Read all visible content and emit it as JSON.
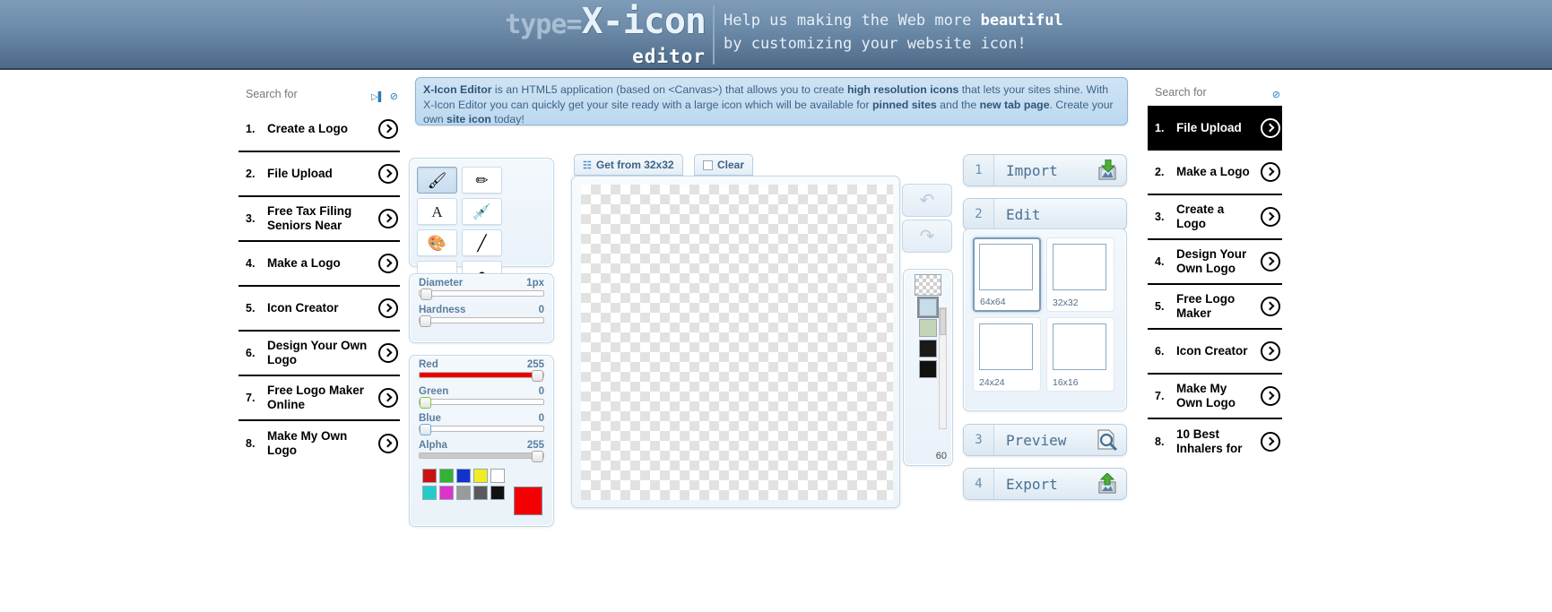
{
  "header": {
    "logo_type": "type=",
    "logo_name": "X-icon",
    "logo_sub": "editor",
    "tagline_line1_pre": "Help us making the Web more ",
    "tagline_line1_bold": "beautiful",
    "tagline_line2": "by customizing your website icon!"
  },
  "info_banner": {
    "b1": "X-Icon Editor",
    "t1": " is an HTML5 application (based on <Canvas>) that allows you to create ",
    "b2": "high resolution icons",
    "t2": " that lets your sites shine. With X-Icon Editor you can quickly get your site ready with a large icon which will be available for ",
    "b3": "pinned sites",
    "t3": " and the ",
    "b4": "new tab page",
    "t4": ". Create your own ",
    "b5": "site icon",
    "t5": " today!"
  },
  "ads_left": {
    "heading": "Search for",
    "adchoices_label": "▷▐",
    "hide_icon": "eye-slash-icon",
    "items": [
      {
        "num": "1.",
        "label": "Create a Logo"
      },
      {
        "num": "2.",
        "label": "File Upload"
      },
      {
        "num": "3.",
        "label": "Free Tax Filing Seniors Near"
      },
      {
        "num": "4.",
        "label": "Make a Logo"
      },
      {
        "num": "5.",
        "label": "Icon Creator"
      },
      {
        "num": "6.",
        "label": "Design Your Own Logo"
      },
      {
        "num": "7.",
        "label": "Free Logo Maker Online"
      },
      {
        "num": "8.",
        "label": "Make My Own Logo"
      }
    ]
  },
  "ads_right": {
    "heading": "Search for",
    "hide_icon": "eye-slash-icon",
    "items": [
      {
        "num": "1.",
        "label": "File Upload",
        "highlighted": true
      },
      {
        "num": "2.",
        "label": "Make a Logo"
      },
      {
        "num": "3.",
        "label": "Create a Logo"
      },
      {
        "num": "4.",
        "label": "Design Your Own Logo"
      },
      {
        "num": "5.",
        "label": "Free Logo Maker"
      },
      {
        "num": "6.",
        "label": "Icon Creator"
      },
      {
        "num": "7.",
        "label": "Make My Own Logo"
      },
      {
        "num": "8.",
        "label": "10 Best Inhalers for"
      }
    ]
  },
  "tools": [
    {
      "name": "paintbrush-tool",
      "glyph": "🖌",
      "active": true
    },
    {
      "name": "pencil-tool",
      "glyph": "✏",
      "active": false
    },
    {
      "name": "text-tool",
      "glyph": "A",
      "active": false,
      "text": true
    },
    {
      "name": "eyedropper-tool",
      "glyph": "💉",
      "active": false
    },
    {
      "name": "palette-tool",
      "glyph": "🎨",
      "active": false
    },
    {
      "name": "line-tool",
      "glyph": "╱",
      "active": false
    },
    {
      "name": "rectangle-tool",
      "glyph": "▬",
      "active": false
    },
    {
      "name": "ellipse-tool",
      "glyph": "●",
      "active": false
    },
    {
      "name": "eraser-tool",
      "glyph": "🧹",
      "active": false
    }
  ],
  "brush": {
    "diameter_label": "Diameter",
    "diameter_value": "1px",
    "diameter_pct": 1,
    "hardness_label": "Hardness",
    "hardness_value": "0",
    "hardness_pct": 0
  },
  "color": {
    "red_label": "Red",
    "red_value": "255",
    "red_pct": 100,
    "green_label": "Green",
    "green_value": "0",
    "green_pct": 0,
    "blue_label": "Blue",
    "blue_value": "0",
    "blue_pct": 0,
    "alpha_label": "Alpha",
    "alpha_value": "255",
    "alpha_pct": 100,
    "current": "#f40000",
    "swatches_row1": [
      "#cc1111",
      "#33b233",
      "#1133cc",
      "#eeee22",
      "#ffffff"
    ],
    "swatches_row2": [
      "#22cccc",
      "#dd33cc",
      "#9a9a9a",
      "#5a5a5a",
      "#111111"
    ]
  },
  "canvas": {
    "tab_get_label": "Get from 32x32",
    "tab_get_icon": "resize-icon",
    "tab_clear_label": "Clear",
    "tab_clear_icon": "empty-box-icon"
  },
  "undo_redo": {
    "undo_icon": "undo-arrow-icon",
    "undo_glyph": "↶",
    "redo_icon": "redo-arrow-icon",
    "redo_glyph": "↷"
  },
  "history": {
    "count_label": "60",
    "swatches": [
      "#c8ddea",
      "#c3d4b8",
      "#1a1a1a",
      "#111111"
    ]
  },
  "steps": {
    "import": {
      "num": "1",
      "label": "Import",
      "icon": "import-image-icon",
      "glyph": "🖼"
    },
    "edit": {
      "num": "2",
      "label": "Edit",
      "icon": "edit-icon",
      "glyph": ""
    },
    "preview": {
      "num": "3",
      "label": "Preview",
      "icon": "preview-magnifier-icon",
      "glyph": "🔍"
    },
    "export": {
      "num": "4",
      "label": "Export",
      "icon": "export-image-icon",
      "glyph": "🖼"
    }
  },
  "sizes": [
    {
      "label": "64x64",
      "selected": true
    },
    {
      "label": "32x32",
      "selected": false
    },
    {
      "label": "24x24",
      "selected": false
    },
    {
      "label": "16x16",
      "selected": false
    }
  ]
}
